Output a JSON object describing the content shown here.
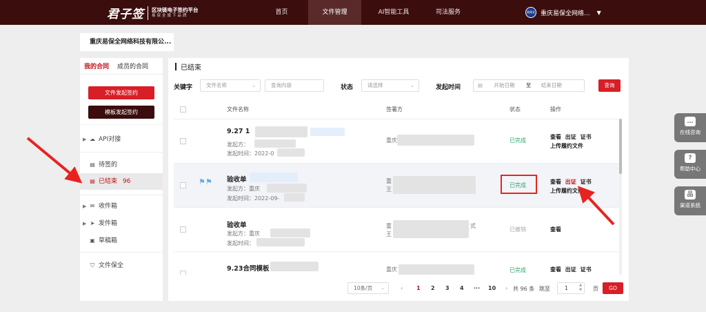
{
  "header": {
    "logo_main": "君子签",
    "logo_sub1": "区块链电子签约平台",
    "logo_sub2": "易保全旗下品牌",
    "nav": [
      {
        "label": "首页",
        "active": false
      },
      {
        "label": "文件管理",
        "active": true
      },
      {
        "label": "AI智能工具",
        "active": false
      },
      {
        "label": "司法服务",
        "active": false
      }
    ],
    "avatar_text": "易保全网络",
    "company": "重庆易保全网络..."
  },
  "tab": {
    "label": "重庆易保全网络科技有限公..."
  },
  "sidebar": {
    "tabs": [
      "我的合同",
      "成员的合同"
    ],
    "btn_file": "文件发起签约",
    "btn_template": "模板发起签约",
    "api": "API对接",
    "pending": "待签的",
    "finished": "已结束",
    "finished_count": "96",
    "inbox": "收件箱",
    "outbox": "发件箱",
    "drafts": "草稿箱",
    "preserve": "文件保全"
  },
  "main": {
    "title": "已结束",
    "filters": {
      "keyword_label": "关键字",
      "keyword_select": "文件名称",
      "keyword_placeholder": "查询内容",
      "status_label": "状态",
      "status_placeholder": "请选择",
      "time_label": "发起时间",
      "start_placeholder": "开始日期",
      "to": "至",
      "end_placeholder": "结束日期",
      "search_btn": "查询"
    },
    "columns": {
      "name": "文件名称",
      "signer": "签署方",
      "status": "状态",
      "ops": "操作"
    },
    "rows": [
      {
        "title": "9.27 1",
        "from": "发起方：",
        "time": "发起时间：2022-0",
        "signer": "重庆",
        "status": "已完成",
        "op1": "查看",
        "op2": "出证",
        "op3": "证书",
        "op4": "上传履约文件"
      },
      {
        "title": "验收单",
        "from": "发起方：重庆",
        "time": "发起时间：2022-09-",
        "signer1": "重",
        "signer2": "王",
        "status": "已完成",
        "op1": "查看",
        "op2": "出证",
        "op3": "证书",
        "op4": "上传履约文件"
      },
      {
        "title": "验收单",
        "from": "发起方：重庆",
        "time": "发起时间：",
        "signer1": "重",
        "signer1_tail": "式",
        "signer2": "王",
        "status": "已撤销",
        "op1": "查看"
      },
      {
        "title": "9.23合同模板",
        "signer": "重庆",
        "status": "已完成",
        "op1": "查看",
        "op2": "出证",
        "op3": "证书"
      }
    ],
    "pager": {
      "size": "10条/页",
      "pages": [
        "1",
        "2",
        "3",
        "4",
        "···",
        "10"
      ],
      "current": "1",
      "total": "共 96 条",
      "jump": "跳至",
      "jump_value": "1",
      "unit": "页",
      "go": "GO"
    }
  },
  "float": {
    "chat": "在线咨询",
    "help": "帮助中心",
    "channel": "渠道系统"
  }
}
